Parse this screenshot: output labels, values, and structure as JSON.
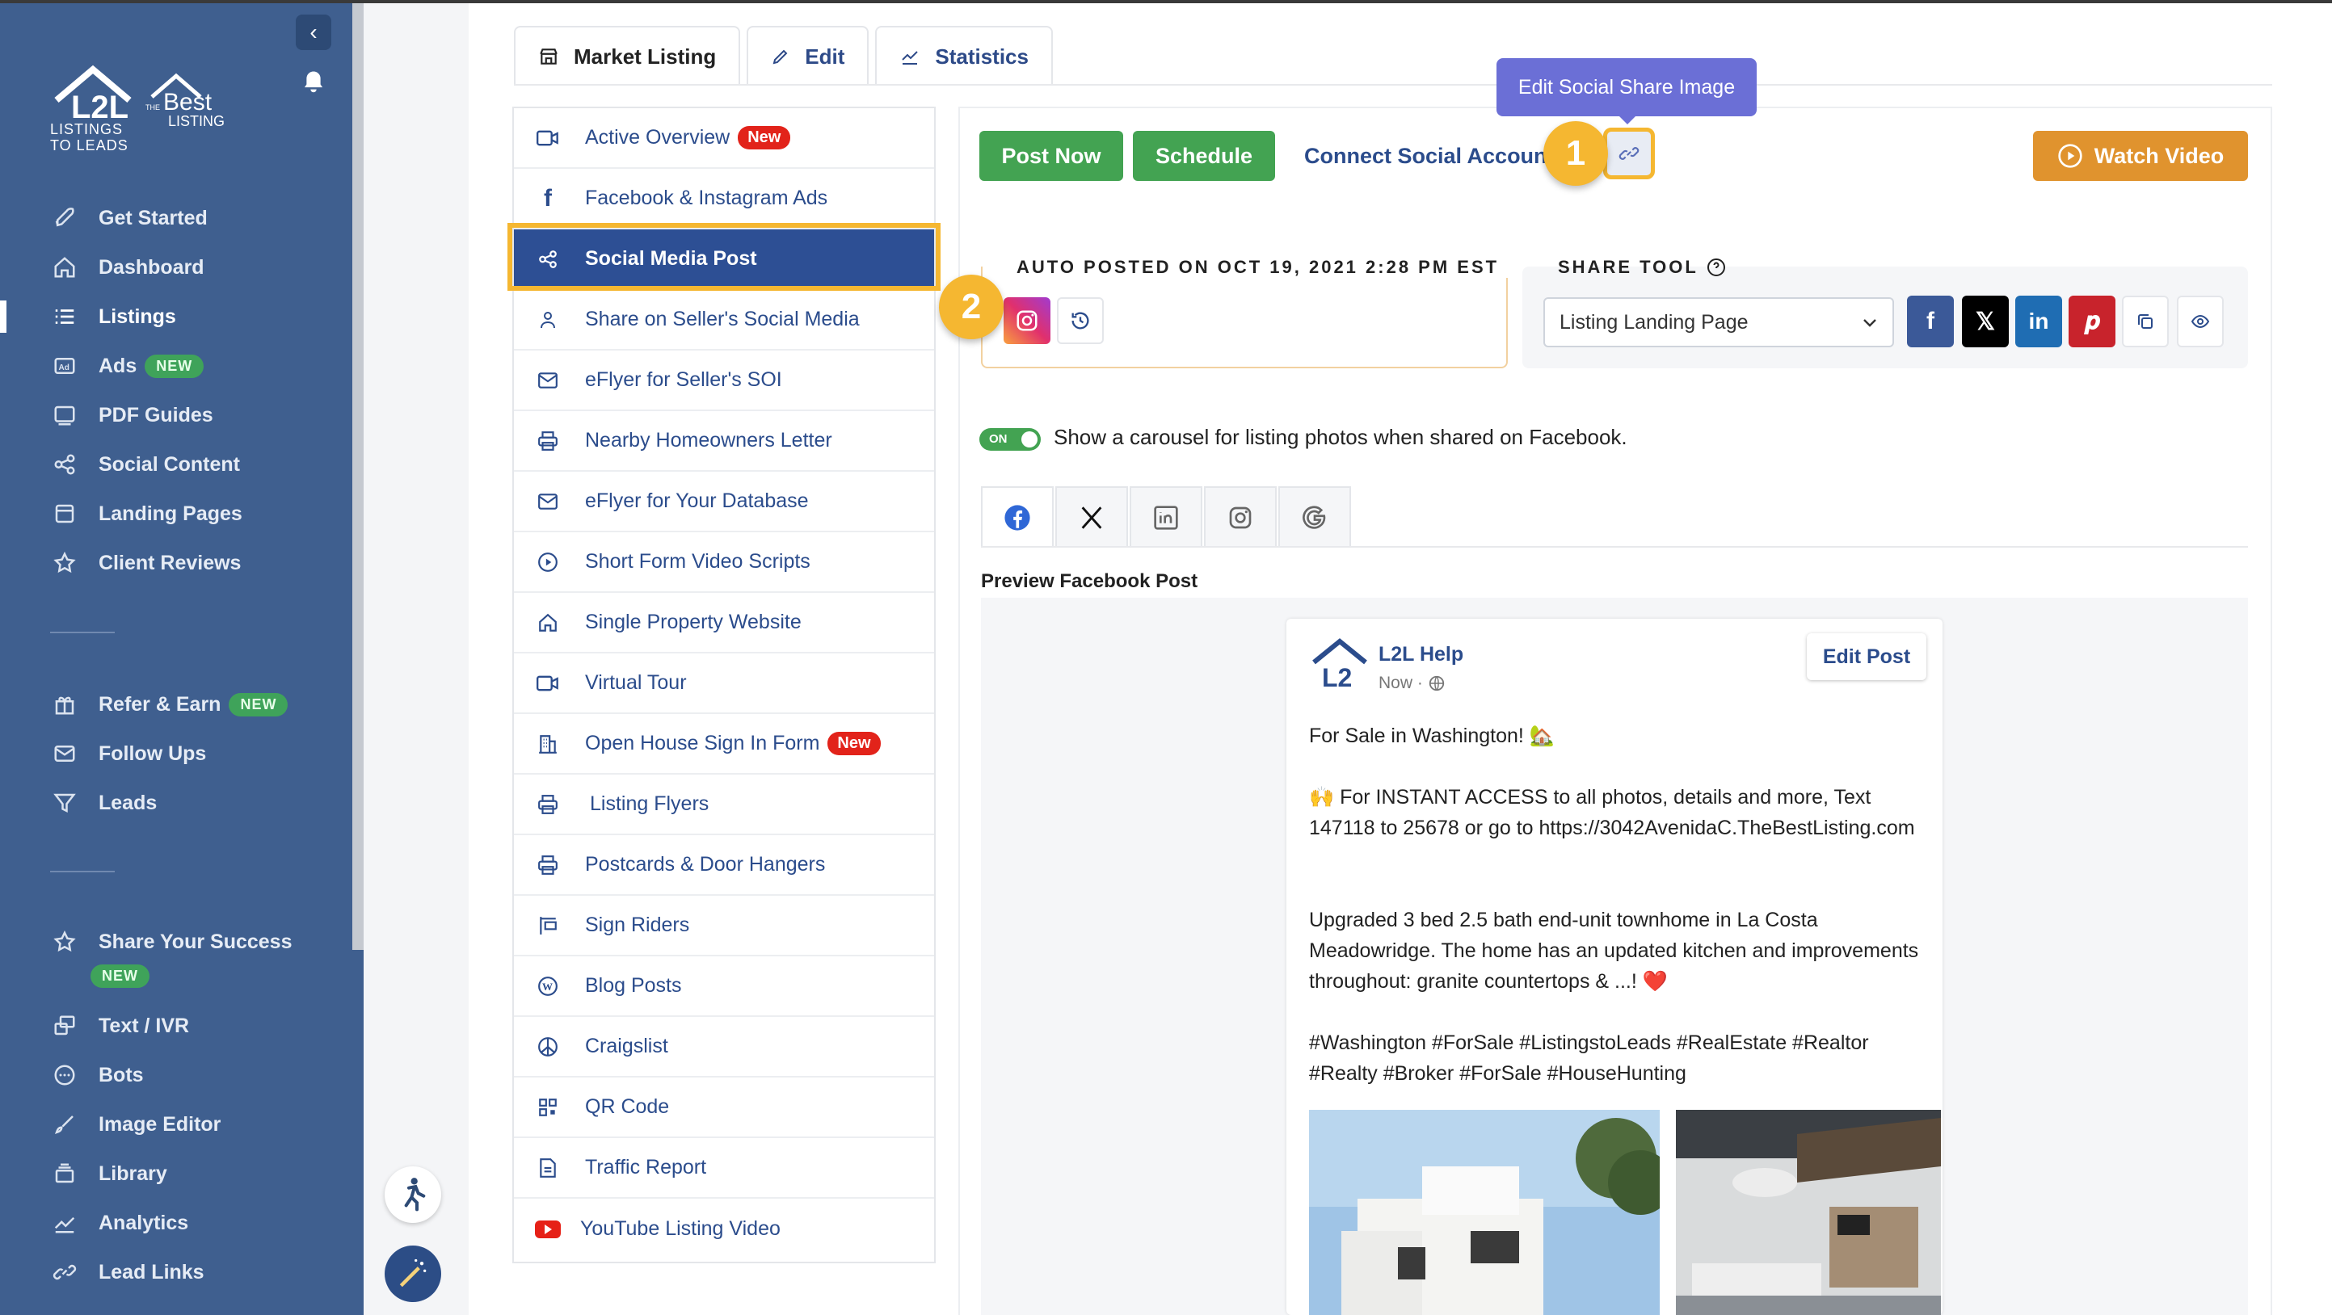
{
  "sidebar": {
    "brand_sub": "LISTINGS\nTO LEADS",
    "items": [
      {
        "label": "Get Started",
        "icon": "rocket-icon"
      },
      {
        "label": "Dashboard",
        "icon": "home-icon"
      },
      {
        "label": "Listings",
        "icon": "list-icon",
        "active": true
      },
      {
        "label": "Ads",
        "icon": "ad-icon",
        "badge": "NEW"
      },
      {
        "label": "PDF Guides",
        "icon": "pdf-icon"
      },
      {
        "label": "Social Content",
        "icon": "share-icon"
      },
      {
        "label": "Landing Pages",
        "icon": "page-icon"
      },
      {
        "label": "Client Reviews",
        "icon": "star-icon"
      },
      {
        "label": "Refer & Earn",
        "icon": "gift-icon",
        "badge": "NEW"
      },
      {
        "label": "Follow Ups",
        "icon": "mail-icon"
      },
      {
        "label": "Leads",
        "icon": "filter-icon"
      },
      {
        "label": "Share Your Success",
        "icon": "star-icon",
        "badge": "NEW"
      },
      {
        "label": "Text / IVR",
        "icon": "chat-icon"
      },
      {
        "label": "Bots",
        "icon": "bot-icon"
      },
      {
        "label": "Image Editor",
        "icon": "brush-icon"
      },
      {
        "label": "Library",
        "icon": "library-icon"
      },
      {
        "label": "Analytics",
        "icon": "chart-icon"
      },
      {
        "label": "Lead Links",
        "icon": "link-icon"
      }
    ]
  },
  "tabs": [
    {
      "label": "Market Listing",
      "icon": "store-icon"
    },
    {
      "label": "Edit",
      "icon": "pencil-icon"
    },
    {
      "label": "Statistics",
      "icon": "chart-icon"
    }
  ],
  "submenu": [
    {
      "label": "Active Overview",
      "icon": "video-icon",
      "badge": "New"
    },
    {
      "label": "Facebook & Instagram Ads",
      "icon": "facebook-icon"
    },
    {
      "label": "Social Media Post",
      "icon": "share-icon",
      "active": true
    },
    {
      "label": "Share on Seller's Social Media",
      "icon": "user-icon"
    },
    {
      "label": "eFlyer for Seller's SOI",
      "icon": "mail-icon"
    },
    {
      "label": "Nearby Homeowners Letter",
      "icon": "printer-icon"
    },
    {
      "label": "eFlyer for Your Database",
      "icon": "mail-icon"
    },
    {
      "label": "Short Form Video Scripts",
      "icon": "play-icon"
    },
    {
      "label": "Single Property Website",
      "icon": "home-icon"
    },
    {
      "label": "Virtual Tour",
      "icon": "video-icon"
    },
    {
      "label": "Open House Sign In Form",
      "icon": "building-icon",
      "badge": "New"
    },
    {
      "label": "Listing Flyers",
      "icon": "printer-icon"
    },
    {
      "label": "Postcards & Door Hangers",
      "icon": "printer-icon"
    },
    {
      "label": "Sign Riders",
      "icon": "sign-icon"
    },
    {
      "label": "Blog Posts",
      "icon": "wordpress-icon"
    },
    {
      "label": "Craigslist",
      "icon": "peace-icon"
    },
    {
      "label": "QR Code",
      "icon": "qr-icon"
    },
    {
      "label": "Traffic Report",
      "icon": "file-icon"
    },
    {
      "label": "YouTube Listing Video",
      "icon": "youtube-icon"
    }
  ],
  "actions": {
    "post_now": "Post Now",
    "schedule": "Schedule",
    "connect": "Connect Social Accounts",
    "watch_video": "Watch Video",
    "tooltip": "Edit Social Share Image",
    "step1": "1",
    "step2": "2"
  },
  "auto_posted": {
    "title": "AUTO POSTED ON OCT 19, 2021 2:28 PM EST"
  },
  "share_tool": {
    "title": "SHARE TOOL",
    "selected": "Listing Landing Page"
  },
  "carousel": {
    "toggle_label": "ON",
    "text": "Show a carousel for listing photos when shared on Facebook."
  },
  "preview": {
    "label": "Preview Facebook Post",
    "page_name": "L2L Help",
    "time": "Now ·",
    "edit_button": "Edit Post",
    "line1": "For Sale in Washington! 🏡",
    "line2": "🙌 For INSTANT ACCESS to all photos, details and more, Text 147118 to 25678 or go to https://3042AvenidaC.TheBestListing.com",
    "line3": "Upgraded 3 bed 2.5 bath end-unit townhome in La Costa Meadowridge. The home has an updated kitchen and improvements throughout: granite countertops & ...! ❤️",
    "line4": "#Washington #ForSale #ListingstoLeads #RealEstate #Realtor #Realty #Broker #ForSale #HouseHunting"
  },
  "colors": {
    "sidebar": "#3f5f8f",
    "primary": "#2b4c8c",
    "green": "#43a352",
    "orange": "#e0932e",
    "highlight": "#f5b731"
  }
}
